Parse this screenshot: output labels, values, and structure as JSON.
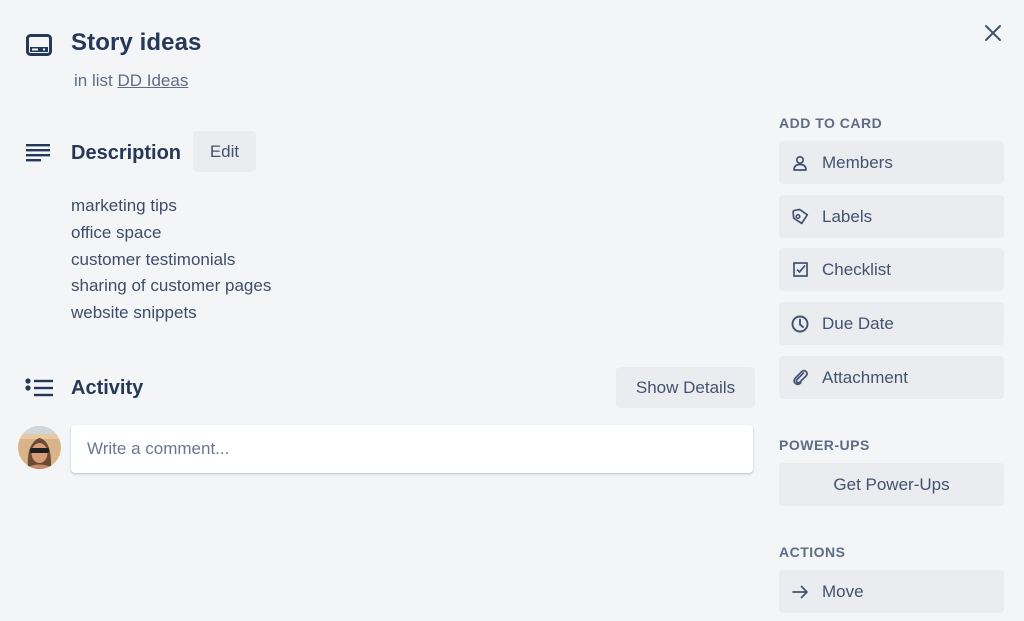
{
  "card": {
    "title": "Story ideas",
    "list_prefix": "in list",
    "list_name": "DD Ideas"
  },
  "description": {
    "title": "Description",
    "edit_label": "Edit",
    "lines": [
      "marketing tips",
      "office space",
      "customer testimonials",
      "sharing of customer pages",
      "website snippets"
    ]
  },
  "activity": {
    "title": "Activity",
    "show_details_label": "Show Details",
    "comment_placeholder": "Write a comment...",
    "comment_value": ""
  },
  "sidebar": {
    "add_to_card": {
      "heading": "ADD TO CARD",
      "items": [
        {
          "label": "Members",
          "icon": "person-icon"
        },
        {
          "label": "Labels",
          "icon": "tag-icon"
        },
        {
          "label": "Checklist",
          "icon": "checkbox-icon"
        },
        {
          "label": "Due Date",
          "icon": "clock-icon"
        },
        {
          "label": "Attachment",
          "icon": "paperclip-icon"
        }
      ]
    },
    "power_ups": {
      "heading": "POWER-UPS",
      "button_label": "Get Power-Ups"
    },
    "actions": {
      "heading": "ACTIONS",
      "items": [
        {
          "label": "Move",
          "icon": "arrow-right-icon"
        }
      ]
    }
  },
  "colors": {
    "background": "#f4f5f7",
    "button_bg": "#ebecf0",
    "title_text": "#253858",
    "muted_text": "#5e6c84"
  }
}
